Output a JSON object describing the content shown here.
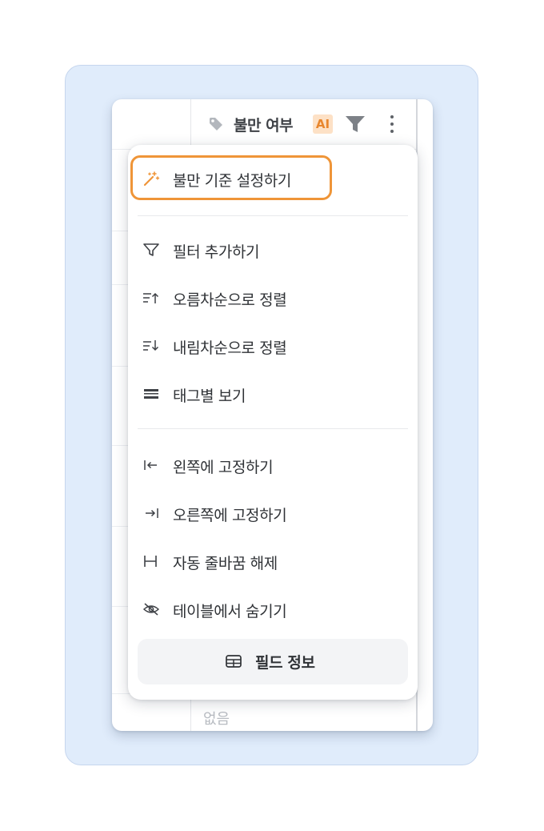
{
  "header": {
    "column_title": "불만 여부",
    "ai_badge": "AI",
    "tag_icon": "tag-icon",
    "filter_icon": "filter-icon",
    "more_icon": "more-vertical-icon"
  },
  "table": {
    "bottom_cell_value": "없음"
  },
  "menu": {
    "items": [
      {
        "label": "불만 기준 설정하기",
        "icon": "magic-wand-icon",
        "accent": "#ef9538"
      },
      {
        "label": "필터 추가하기",
        "icon": "filter-outline-icon"
      },
      {
        "label": "오름차순으로 정렬",
        "icon": "sort-ascending-icon"
      },
      {
        "label": "내림차순으로 정렬",
        "icon": "sort-descending-icon"
      },
      {
        "label": "태그별 보기",
        "icon": "group-by-tag-icon"
      },
      {
        "label": "왼쪽에 고정하기",
        "icon": "pin-left-icon"
      },
      {
        "label": "오른쪽에 고정하기",
        "icon": "pin-right-icon"
      },
      {
        "label": "자동 줄바꿈 해제",
        "icon": "wrap-off-icon"
      },
      {
        "label": "테이블에서 숨기기",
        "icon": "eye-off-icon"
      }
    ],
    "footer_button": {
      "label": "필드 정보",
      "icon": "table-info-icon"
    }
  },
  "colors": {
    "panel_background": "#e0ecfb",
    "highlight": "#ef9538",
    "ai_badge_bg": "#fde1c6",
    "ai_badge_text": "#e8862d"
  }
}
